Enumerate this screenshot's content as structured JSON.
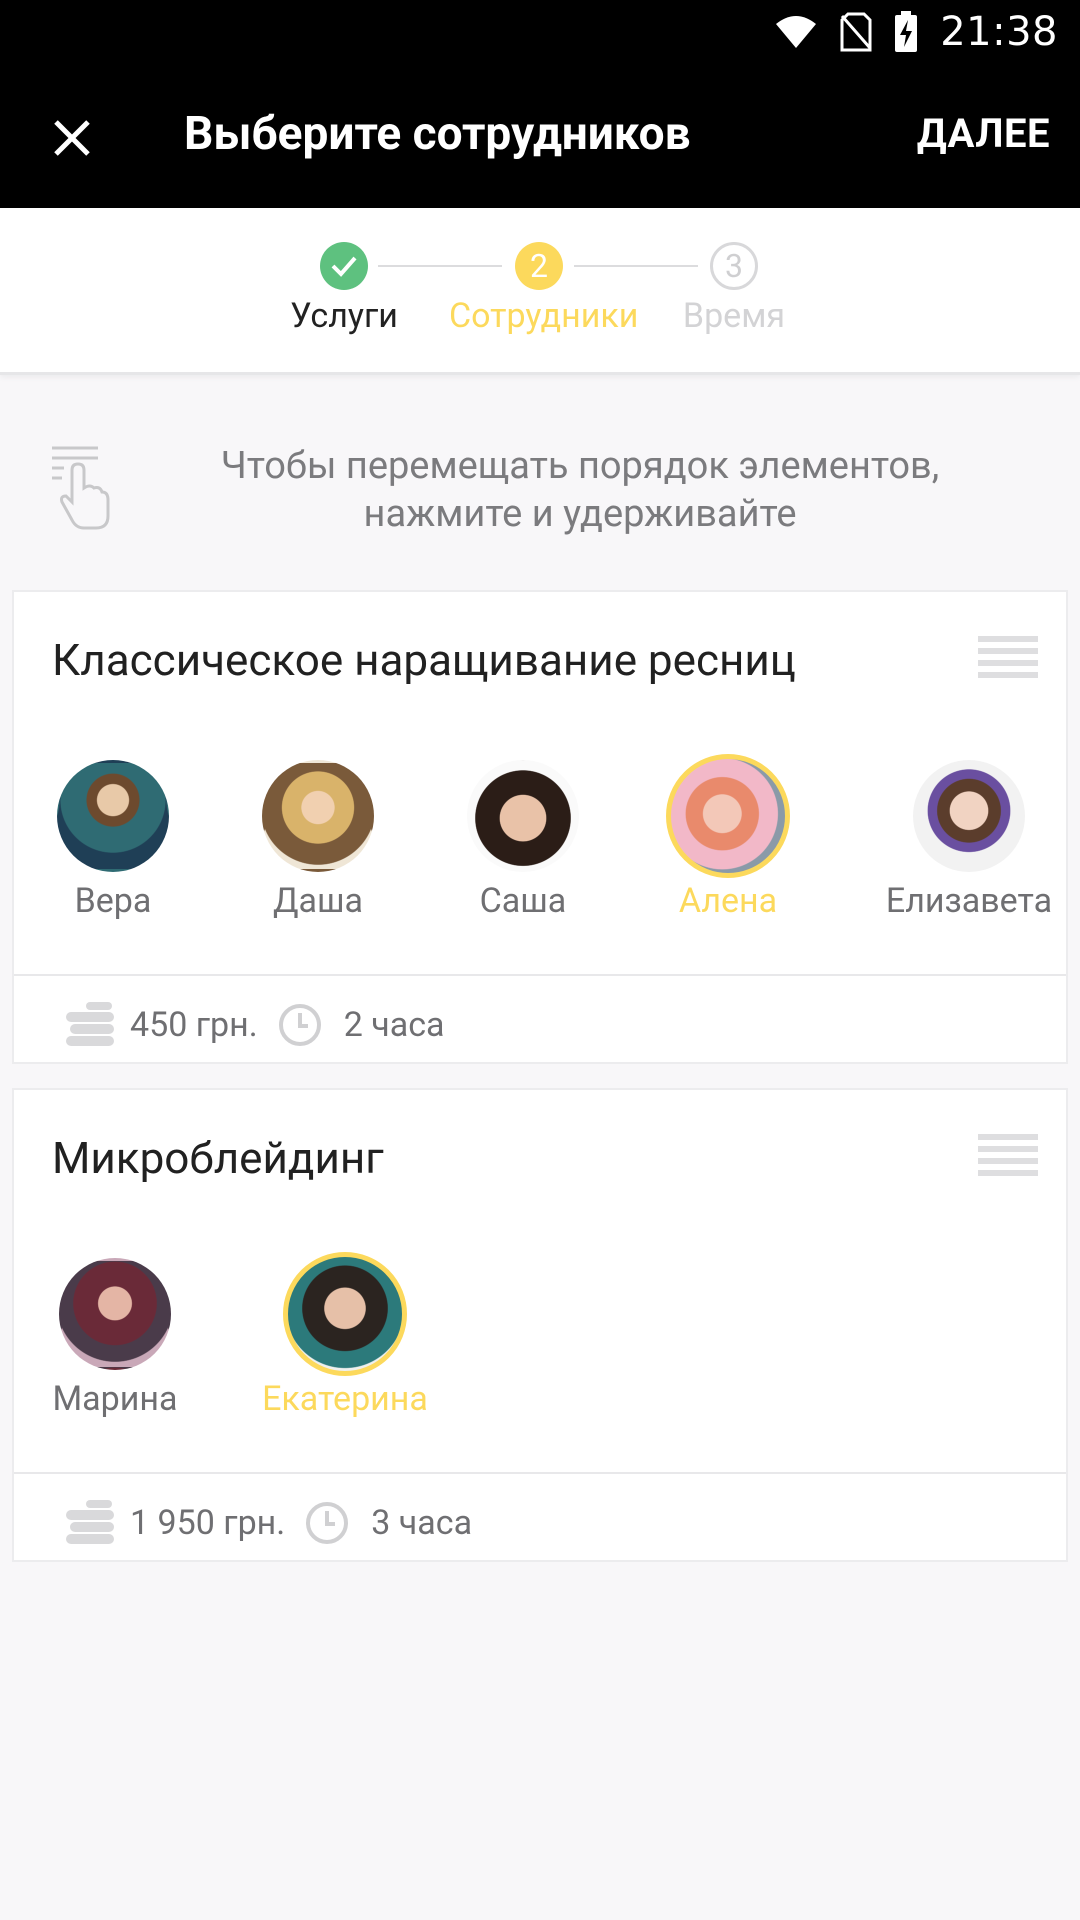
{
  "status_bar": {
    "time": "21:38",
    "icons": [
      "wifi-icon",
      "no-sim-icon",
      "battery-charging-icon"
    ]
  },
  "app_bar": {
    "title": "Выберите сотрудников",
    "next_label": "ДАЛЕЕ",
    "close_icon": "close-icon"
  },
  "stepper": {
    "steps": [
      {
        "label": "Услуги",
        "state": "done",
        "marker": "✓"
      },
      {
        "label": "Сотрудники",
        "state": "active",
        "marker": "2"
      },
      {
        "label": "Время",
        "state": "pending",
        "marker": "3"
      }
    ]
  },
  "hint": {
    "text_line1": "Чтобы перемещать порядок элементов,",
    "text_line2": "нажмите и удерживайте",
    "icon": "touch-hold-icon"
  },
  "colors": {
    "accent_yellow": "#fcd95c",
    "done_green": "#5ec17f",
    "app_bar": "#000000"
  },
  "services": [
    {
      "title": "Классическое наращивание ресниц",
      "staff": [
        {
          "name": "Вера",
          "selected": false
        },
        {
          "name": "Даша",
          "selected": false
        },
        {
          "name": "Саша",
          "selected": false
        },
        {
          "name": "Алена",
          "selected": true
        },
        {
          "name": "Елизавета",
          "selected": false
        }
      ],
      "price": "450 грн.",
      "duration": "2 часа"
    },
    {
      "title": "Микроблейдинг",
      "staff": [
        {
          "name": "Марина",
          "selected": false
        },
        {
          "name": "Екатерина",
          "selected": true
        }
      ],
      "price": "1 950 грн.",
      "duration": "3 часа"
    }
  ]
}
